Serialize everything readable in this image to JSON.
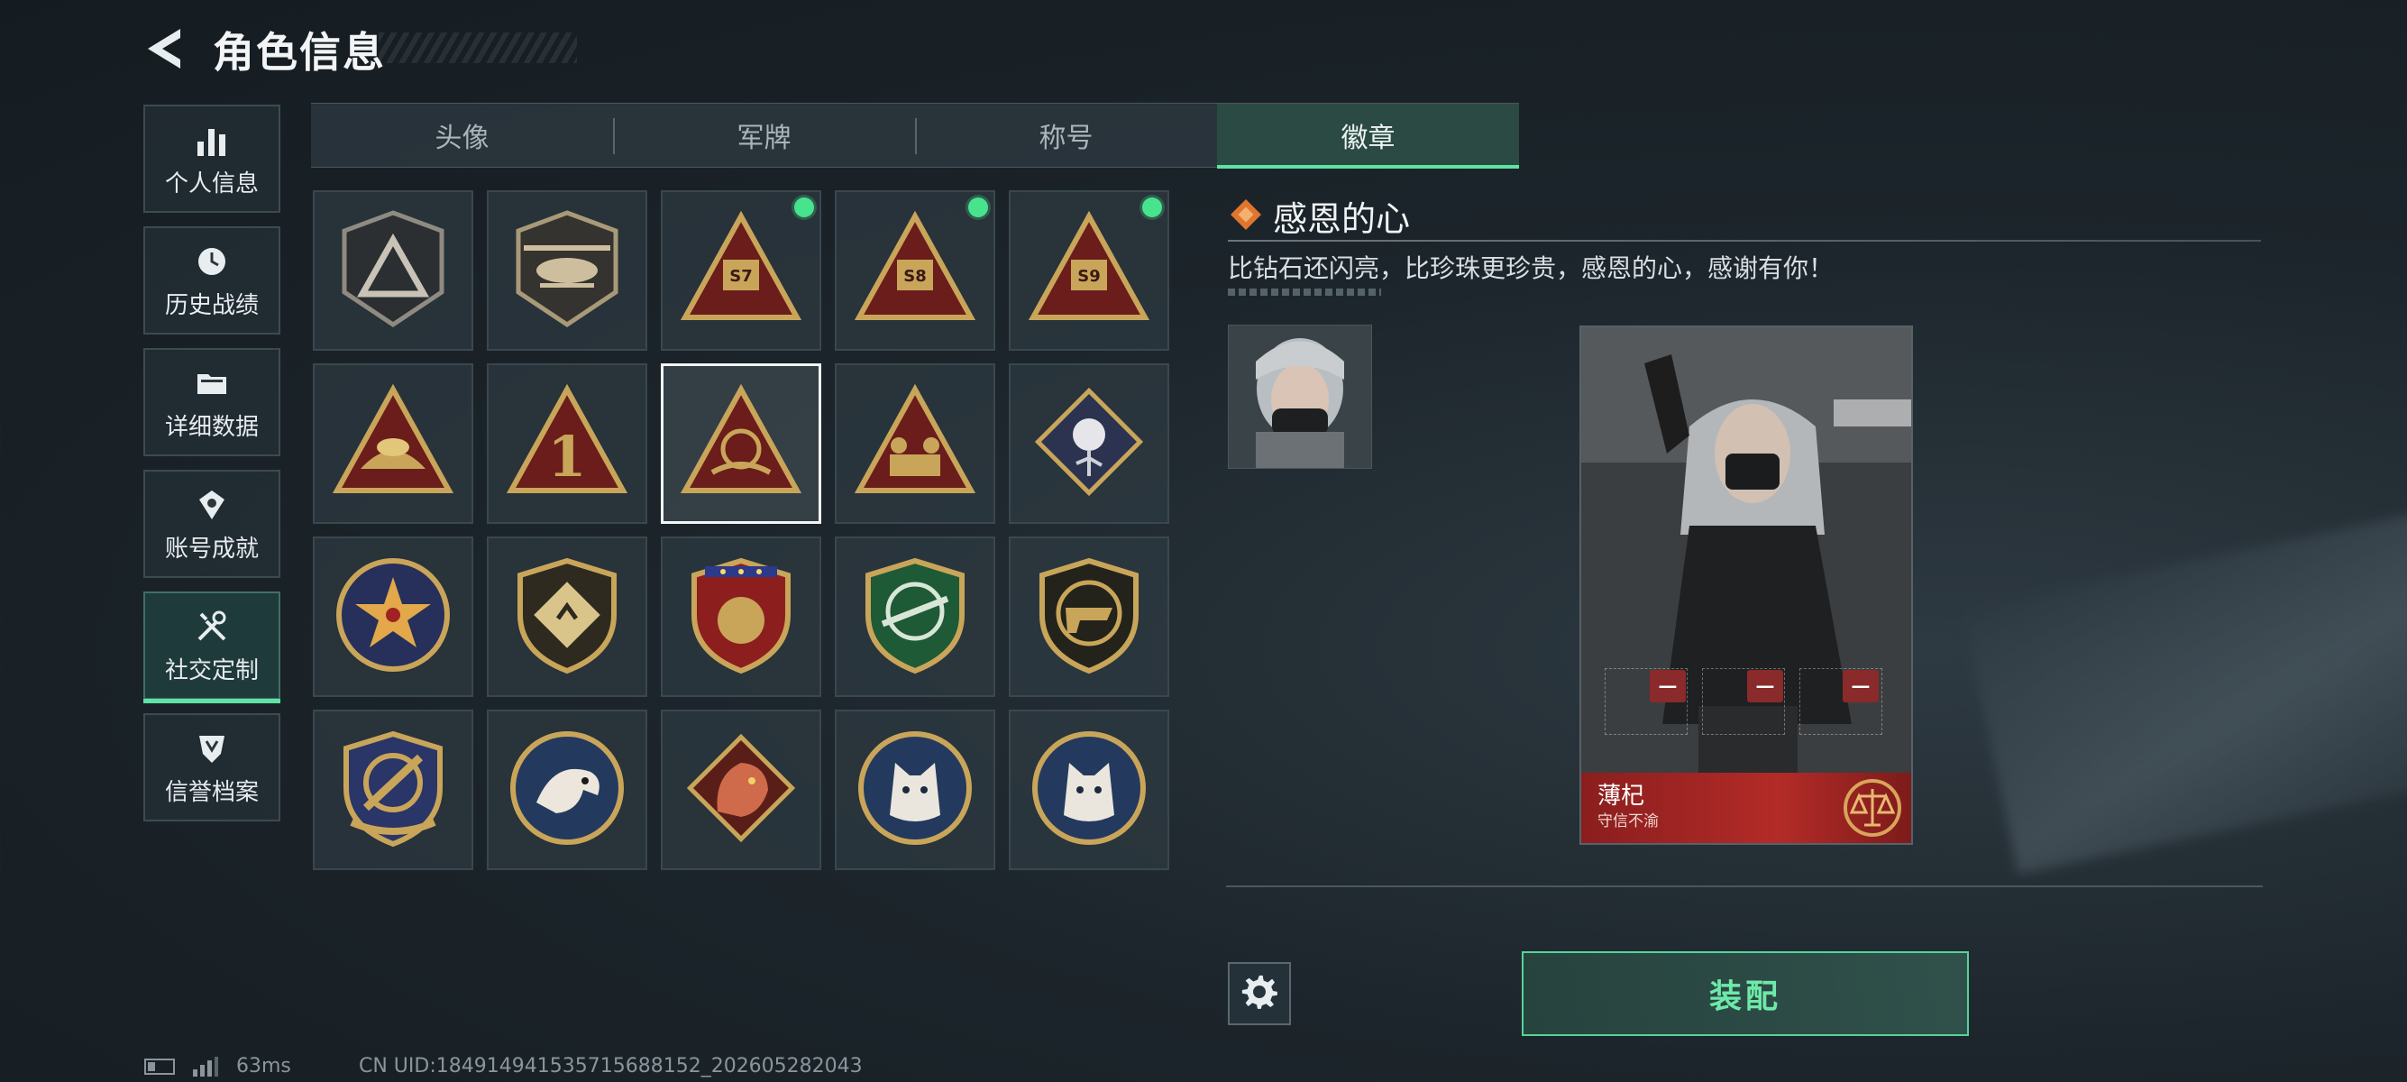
{
  "header": {
    "title": "角色信息",
    "back_icon": "back-arrow-icon"
  },
  "sidebar": {
    "items": [
      {
        "label": "个人信息",
        "icon": "bar-chart-icon",
        "active": false
      },
      {
        "label": "历史战绩",
        "icon": "history-clock-icon",
        "active": false
      },
      {
        "label": "详细数据",
        "icon": "folder-icon",
        "active": false
      },
      {
        "label": "账号成就",
        "icon": "medal-icon",
        "active": false
      },
      {
        "label": "社交定制",
        "icon": "tools-icon",
        "active": true
      },
      {
        "label": "信誉档案",
        "icon": "shield-rank-icon",
        "active": false
      }
    ]
  },
  "tabs": [
    {
      "label": "头像",
      "active": false
    },
    {
      "label": "军牌",
      "active": false
    },
    {
      "label": "称号",
      "active": false
    },
    {
      "label": "徽章",
      "active": true
    }
  ],
  "badges": [
    {
      "name": "gray-triangle-badge",
      "equipped": false,
      "selected": false
    },
    {
      "name": "helicopter-badge",
      "equipped": false,
      "selected": false
    },
    {
      "name": "s7-badge",
      "label": "S7",
      "equipped": true,
      "selected": false
    },
    {
      "name": "s8-badge",
      "label": "S8",
      "equipped": true,
      "selected": false
    },
    {
      "name": "s9-badge",
      "label": "S9",
      "equipped": true,
      "selected": false
    },
    {
      "name": "hands-triangle-badge",
      "equipped": false,
      "selected": false
    },
    {
      "name": "number-one-badge",
      "label": "1",
      "equipped": false,
      "selected": false
    },
    {
      "name": "grateful-heart-badge",
      "equipped": false,
      "selected": true
    },
    {
      "name": "soldiers-triangle-badge",
      "equipped": false,
      "selected": false
    },
    {
      "name": "rose-diamond-badge",
      "equipped": false,
      "selected": false
    },
    {
      "name": "star-emblem-badge",
      "equipped": false,
      "selected": false
    },
    {
      "name": "shield-chevron-badge",
      "equipped": false,
      "selected": false
    },
    {
      "name": "stars-shield-badge",
      "equipped": false,
      "selected": false
    },
    {
      "name": "green-rifle-badge",
      "equipped": false,
      "selected": false
    },
    {
      "name": "gold-pistol-badge",
      "equipped": false,
      "selected": false
    },
    {
      "name": "crosshair-shield-badge",
      "equipped": false,
      "selected": false
    },
    {
      "name": "eagle-badge",
      "equipped": false,
      "selected": false
    },
    {
      "name": "dragon-diamond-badge",
      "equipped": false,
      "selected": false
    },
    {
      "name": "wolf-badge-1",
      "equipped": false,
      "selected": false
    },
    {
      "name": "wolf-badge-2",
      "equipped": false,
      "selected": false
    }
  ],
  "detail": {
    "title": "感恩的心",
    "description": "比钻石还闪亮，比珍珠更珍贵，感恩的心，感谢有你！"
  },
  "card": {
    "name": "薄杞",
    "subtitle": "守信不渝"
  },
  "actions": {
    "equip_label": "装配",
    "settings_icon": "gear-icon"
  },
  "footer": {
    "ping": "63ms",
    "uid": "CN UID:18491494153571568815​2_202605282043"
  },
  "colors": {
    "accent_green": "#5fe3a3",
    "equipped_dot": "#48e38d",
    "card_red": "#b32b27",
    "badge_gold": "#c9a55a"
  }
}
